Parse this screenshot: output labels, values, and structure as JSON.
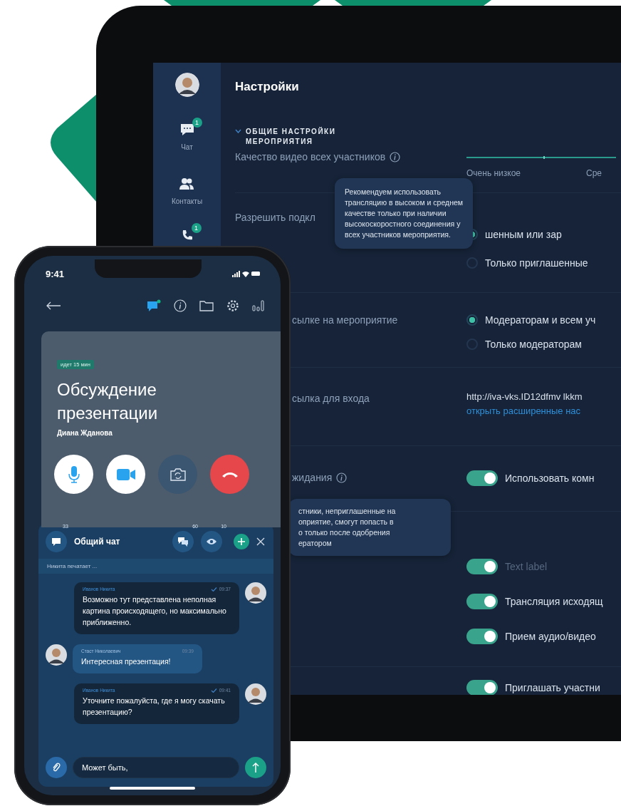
{
  "tablet": {
    "sidebar": {
      "items": [
        {
          "kind": "chat",
          "label": "Чат",
          "badge": "1"
        },
        {
          "kind": "contacts",
          "label": "Контакты"
        },
        {
          "kind": "calls",
          "badge": "1"
        }
      ]
    },
    "title": "Настройки",
    "section": {
      "title": "ОБЩИЕ НАСТРОЙКИ МЕРОПРИЯТИЯ",
      "expanded": true
    },
    "rows": [
      {
        "kind": "slider",
        "label": "Качество видео всех участников",
        "info": true,
        "level": 1,
        "scale": [
          "Очень низкое",
          "Сре"
        ]
      },
      {
        "kind": "radio",
        "label": "Разрешить подкл",
        "options": [
          {
            "label": "шенным или зар",
            "selected": true
          },
          {
            "label": "Только приглашенные",
            "selected": false
          }
        ]
      },
      {
        "kind": "radio",
        "label": "сылке на мероприятие",
        "options": [
          {
            "label": "Модераторам и всем уч",
            "selected": true
          },
          {
            "label": "Только модераторам",
            "selected": false
          }
        ]
      },
      {
        "kind": "link",
        "label": "сылка для входа",
        "value": "http://iva-vks.ID12dfmv lkkm",
        "link": "открыть расширенные нас"
      },
      {
        "kind": "toggle",
        "label": "жидания",
        "info": true,
        "options": [
          {
            "label": "Использовать комн",
            "on": true
          }
        ]
      },
      {
        "kind": "toggle",
        "options": [
          {
            "label": "Text label",
            "on": true,
            "dim": true
          },
          {
            "label": "Трансляция исходящ",
            "on": true
          },
          {
            "label": "Прием аудио/видео",
            "on": true
          }
        ]
      },
      {
        "kind": "toggle",
        "options": [
          {
            "label": "Приглашать участни",
            "on": true
          }
        ]
      }
    ],
    "tooltips": [
      "Рекомендуем использовать\nтрансляцию в высоком и среднем\nкачестве только при наличии\nвысокоскоростного соединения у\nвсех участников мероприятия.",
      "стники, неприглашенные на\nоприятие, смогут попасть в\nо только после одобрения\nератором"
    ]
  },
  "phone": {
    "time": "9:41",
    "call": {
      "badge": "идет 15 мин",
      "title": "Обсуждение\nпрезентации",
      "host": "Диана Жданова"
    },
    "chat": {
      "count": "33",
      "title": "Общий чат",
      "threads_count": "60",
      "viewers_count": "10",
      "typing": "Никита печатает ...",
      "messages": [
        {
          "kind": "outgoing",
          "sender": "Иванов Никита",
          "time": "09:37",
          "text": "Возможно тут представлена неполная картина происходящего, но максимально приближенно."
        },
        {
          "kind": "incoming",
          "sender": "Стаст Николаевич",
          "time": "09:39",
          "text": "Интересная презентация!"
        },
        {
          "kind": "outgoing",
          "sender": "Иванов Никита",
          "time": "09:41",
          "text": "Уточните пожалуйста, где я могу скачать презентацию?"
        }
      ],
      "input": {
        "value": "Может быть,"
      }
    }
  }
}
